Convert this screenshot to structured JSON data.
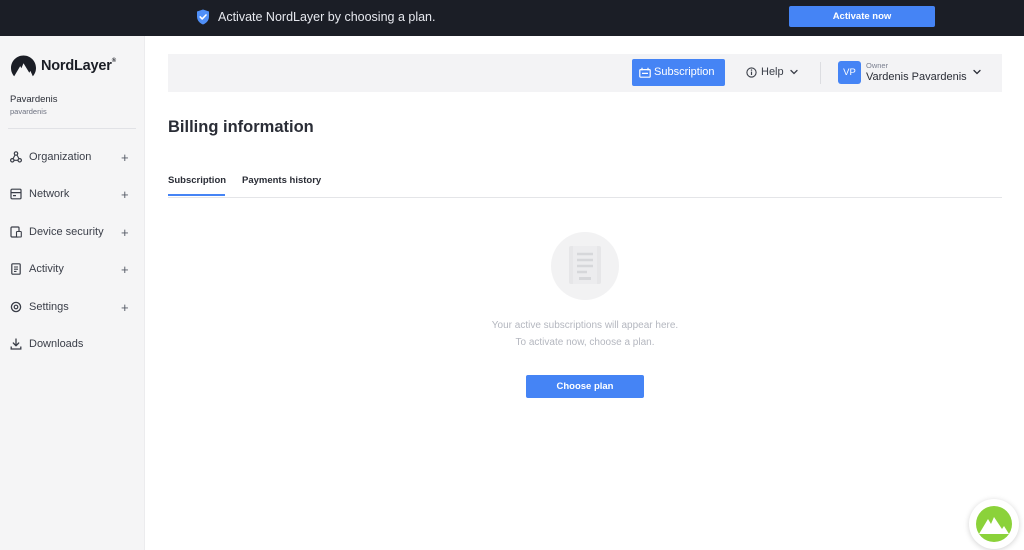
{
  "banner": {
    "text": "Activate NordLayer by choosing a plan.",
    "button_label": "Activate now"
  },
  "sidebar": {
    "brand": "NordLayer",
    "brand_reg": "®",
    "user": {
      "name": "Pavardenis",
      "handle": "pavardenis"
    },
    "items": [
      {
        "label": "Organization",
        "icon": "organization-icon",
        "expandable": true
      },
      {
        "label": "Network",
        "icon": "network-icon",
        "expandable": true
      },
      {
        "label": "Device security",
        "icon": "device-security-icon",
        "expandable": true
      },
      {
        "label": "Activity",
        "icon": "activity-icon",
        "expandable": true
      },
      {
        "label": "Settings",
        "icon": "settings-icon",
        "expandable": true
      },
      {
        "label": "Downloads",
        "icon": "download-icon",
        "expandable": false
      }
    ],
    "plus": "+"
  },
  "header": {
    "subscription_label": "Subscription",
    "help_label": "Help",
    "account": {
      "initials": "VP",
      "role": "Owner",
      "name": "Vardenis Pavardenis"
    }
  },
  "main": {
    "title": "Billing information",
    "tabs": [
      {
        "label": "Subscription",
        "active": true
      },
      {
        "label": "Payments history",
        "active": false
      }
    ],
    "empty": {
      "line1": "Your active subscriptions will appear here.",
      "line2": "To activate now, choose a plan.",
      "button_label": "Choose plan"
    }
  },
  "colors": {
    "accent": "#4584f5",
    "banner_bg": "#1b1e26",
    "sidebar_bg": "#f5f5f6",
    "fab_green": "#8bd23a"
  }
}
